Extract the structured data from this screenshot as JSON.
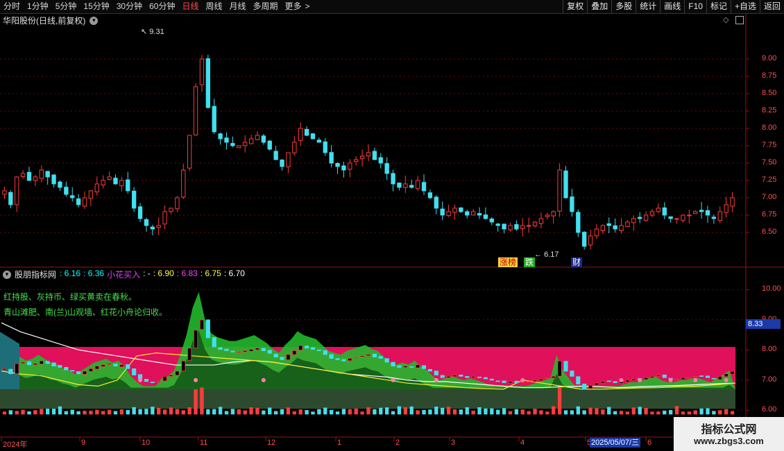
{
  "toolbar": {
    "periods": [
      "分时",
      "1分钟",
      "5分钟",
      "15分钟",
      "30分钟",
      "60分钟",
      "日线",
      "周线",
      "月线",
      "多周期",
      "更多"
    ],
    "active_period": "日线",
    "more_arrow": ">",
    "right_buttons": [
      "复权",
      "叠加",
      "多股",
      "统计",
      "画线",
      "F10",
      "标记",
      "+自选",
      "返回"
    ]
  },
  "stock": {
    "title": "华阳股份(日线,前复权)",
    "max_label": "9.31",
    "min_label": "6.17",
    "tags": {
      "zhangbang": "涨榜",
      "die": "跌",
      "cai": "财"
    }
  },
  "price_axis": [
    "9.00",
    "8.75",
    "8.50",
    "8.25",
    "8.00",
    "7.75",
    "7.50",
    "7.25",
    "7.00",
    "6.75",
    "6.50"
  ],
  "indicator": {
    "name": "股朋指标网",
    "values": [
      {
        "text": ": 6.16",
        "color": "#00ffff"
      },
      {
        "text": ": 6.36",
        "color": "#00ffff"
      },
      {
        "text": "小花买入",
        "color": "#e040ff"
      },
      {
        "text": ": -",
        "color": "#ffffff"
      },
      {
        "text": ": 6.90",
        "color": "#ffff40"
      },
      {
        "text": ": 6.83",
        "color": "#ff40ff"
      },
      {
        "text": ": 6.75",
        "color": "#ffff40"
      },
      {
        "text": ": 6.70",
        "color": "#ffffff"
      }
    ],
    "poem_line1": "红持股、灰持币、绿买黄卖在春秋。",
    "poem_line2": "青山滩肥、南(兰)山观墙、红花小舟论归收。"
  },
  "indicator_axis": [
    "10.00",
    "9.00",
    "8.00",
    "7.00",
    "6.00"
  ],
  "cursor_price": "8.33",
  "dates": [
    "2024年",
    "9",
    "10",
    "11",
    "12",
    "1",
    "2",
    "3",
    "4",
    "5",
    "6"
  ],
  "cursor_date": "2025/05/07/三",
  "watermark": {
    "line1": "指标公式网",
    "line2": "www.zbgs3.com"
  },
  "colors": {
    "up": "#ff3c3c",
    "down": "#40e0f0",
    "grid": "#7a1010",
    "band": "#e0105a"
  },
  "chart_data": {
    "type": "candlestick",
    "price_range": [
      6.2,
      9.45
    ],
    "series": [
      {
        "name": "日线",
        "close": [
          7.1,
          6.9,
          7.3,
          7.35,
          7.25,
          7.3,
          7.4,
          7.3,
          7.2,
          7.15,
          7.05,
          7.0,
          6.9,
          7.0,
          7.1,
          7.2,
          7.25,
          7.3,
          7.2,
          7.25,
          7.1,
          6.85,
          6.7,
          6.6,
          6.55,
          6.6,
          6.8,
          6.85,
          7.0,
          7.4,
          7.9,
          8.6,
          9.0,
          8.3,
          7.95,
          7.85,
          7.8,
          7.75,
          7.75,
          7.8,
          7.85,
          7.9,
          7.8,
          7.7,
          7.55,
          7.45,
          7.65,
          7.8,
          8.0,
          7.9,
          7.85,
          7.8,
          7.65,
          7.5,
          7.45,
          7.4,
          7.5,
          7.55,
          7.6,
          7.65,
          7.55,
          7.5,
          7.35,
          7.2,
          7.15,
          7.2,
          7.15,
          7.25,
          7.1,
          7.0,
          6.85,
          6.75,
          6.8,
          6.85,
          6.8,
          6.75,
          6.8,
          6.75,
          6.7,
          6.65,
          6.6,
          6.55,
          6.6,
          6.55,
          6.6,
          6.6,
          6.65,
          6.7,
          6.75,
          6.8,
          7.4,
          7.0,
          6.8,
          6.5,
          6.3,
          6.45,
          6.55,
          6.6,
          6.6,
          6.55,
          6.6,
          6.65,
          6.7,
          6.7,
          6.75,
          6.8,
          6.85,
          6.75,
          6.7,
          6.7,
          6.75,
          6.75,
          6.8,
          6.8,
          6.75,
          6.7,
          6.8,
          6.9,
          7.0
        ]
      }
    ],
    "indicator_range": [
      5.8,
      10.4
    ],
    "band": {
      "low": 6.7,
      "high": 8.1
    },
    "indicator_lines": [
      {
        "name": "line_white",
        "color": "#ffffff",
        "values": [
          8.9,
          8.6,
          8.4,
          8.2,
          8.0,
          7.9,
          7.8,
          7.7,
          7.6,
          7.5,
          7.5,
          7.5,
          7.6,
          7.65,
          7.6,
          7.5,
          7.4,
          7.3,
          7.2,
          7.15,
          7.1,
          7.0,
          6.95,
          6.95,
          6.9,
          6.85,
          6.8,
          6.75,
          6.75,
          6.78,
          6.8,
          6.78,
          6.75,
          6.78,
          6.8,
          6.82,
          6.85,
          6.88,
          6.9
        ]
      },
      {
        "name": "line_yellow",
        "color": "#ffee30",
        "values": [
          7.3,
          7.2,
          7.15,
          7.0,
          6.85,
          6.8,
          7.0,
          7.8,
          7.9,
          7.85,
          7.8,
          7.75,
          7.7,
          7.65,
          7.6,
          7.5,
          7.4,
          7.3,
          7.2,
          7.1,
          7.0,
          6.9,
          6.85,
          6.8,
          6.75,
          6.72,
          6.7,
          7.0,
          6.9,
          6.8,
          6.7,
          6.7,
          6.72,
          6.74,
          6.75,
          6.78,
          6.8,
          6.85,
          6.9
        ]
      }
    ]
  }
}
